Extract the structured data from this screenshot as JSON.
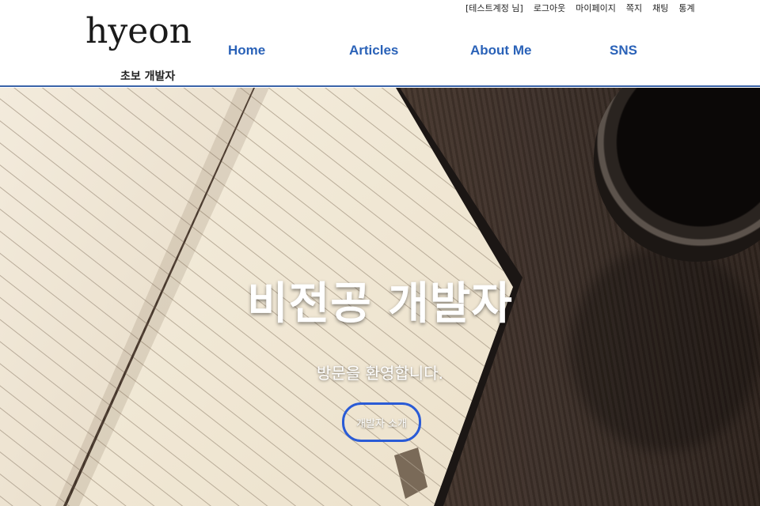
{
  "header": {
    "logo": "hyeon",
    "tagline": "초보 개발자",
    "utility_links": [
      "[테스트계정 님]",
      "로그아웃",
      "마이페이지",
      "쪽지",
      "채팅",
      "통계"
    ],
    "nav": [
      "Home",
      "Articles",
      "About Me",
      "SNS"
    ]
  },
  "hero": {
    "title": "비전공 개발자",
    "subtitle": "방문을 환영합니다.",
    "button_label": "개발자 소개"
  },
  "colors": {
    "nav_text": "#2a62b8",
    "header_border": "#3a63a8",
    "button_border": "#2a5bd6"
  }
}
